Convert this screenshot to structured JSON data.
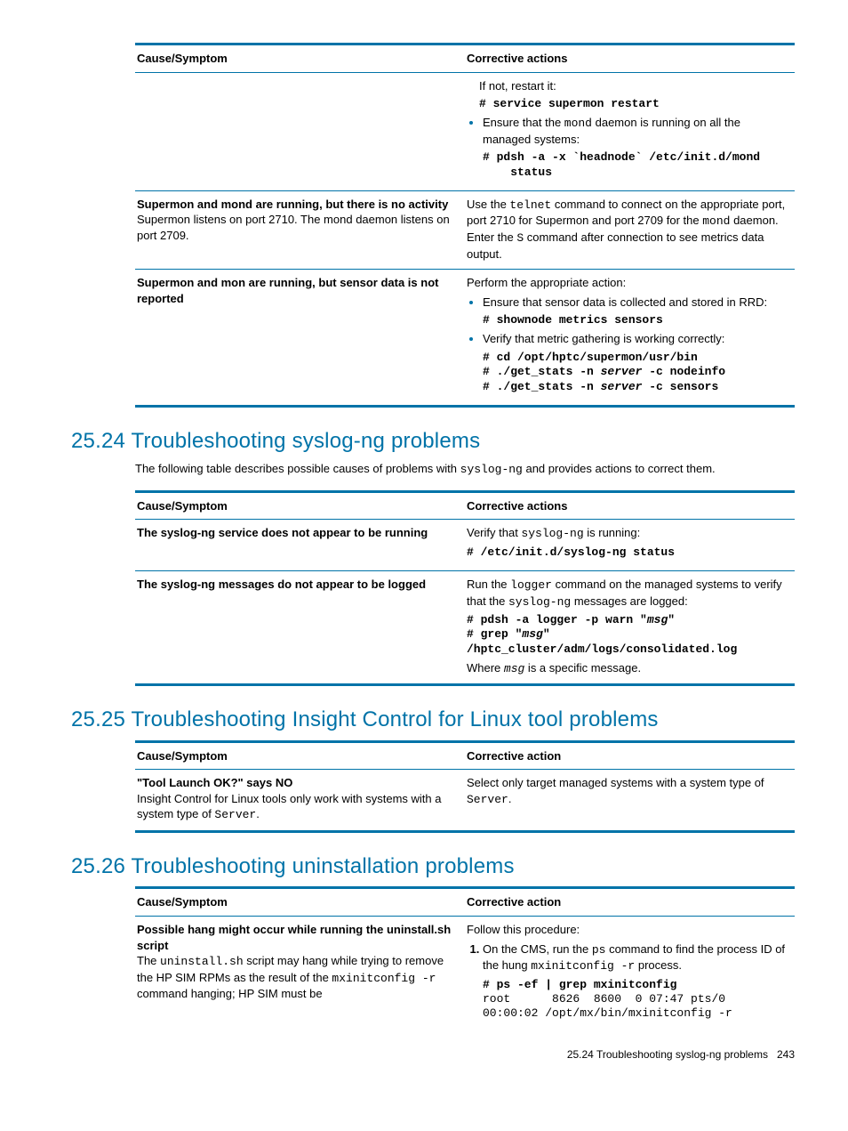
{
  "table1": {
    "headers": {
      "cause": "Cause/Symptom",
      "action": "Corrective actions"
    },
    "rows": [
      {
        "cause_bold": "",
        "cause_text": "",
        "action_intro": "If not, restart it:",
        "action_cmd1": "# service supermon restart",
        "action_bullet1_a": "Ensure that the ",
        "action_bullet1_mono": "mond",
        "action_bullet1_b": " daemon is running on all the managed systems:",
        "action_cmd2": "# pdsh -a -x `headnode` /etc/init.d/mond\n    status"
      },
      {
        "cause_bold": "Supermon and mond are running, but there is no activity",
        "cause_text_a": "Supermon listens on port 2710. The mond daemon listens on port 2709.",
        "action_a": "Use the ",
        "action_mono1": "telnet",
        "action_b": " command to connect on the appropriate port, port 2710 for Supermon and port 2709 for the ",
        "action_mono2": "mond",
        "action_c": " daemon. Enter the ",
        "action_mono3": "S",
        "action_d": " command after connection to see metrics data output."
      },
      {
        "cause_bold": "Supermon and mon are running, but sensor data is not reported",
        "action_intro": "Perform the appropriate action:",
        "bullet1": "Ensure that sensor data is collected and stored in RRD:",
        "cmd1": "# shownode metrics sensors",
        "bullet2": "Verify that metric gathering is working correctly:",
        "cmd2_l1": "# cd /opt/hptc/supermon/usr/bin",
        "cmd2_l2a": "# ./get_stats -n ",
        "cmd2_l2b": "server",
        "cmd2_l2c": " -c nodeinfo",
        "cmd2_l3a": "# ./get_stats -n ",
        "cmd2_l3b": "server",
        "cmd2_l3c": " -c sensors"
      }
    ]
  },
  "section24": {
    "heading": "25.24 Troubleshooting syslog-ng problems",
    "intro_a": "The following table describes possible causes of problems with ",
    "intro_mono": "syslog-ng",
    "intro_b": " and provides actions to correct them."
  },
  "table2": {
    "headers": {
      "cause": "Cause/Symptom",
      "action": "Corrective actions"
    },
    "rows": [
      {
        "cause_bold": "The syslog-ng service does not appear to be running",
        "action_a": "Verify that ",
        "action_mono": "syslog-ng",
        "action_b": " is running:",
        "cmd": "# /etc/init.d/syslog-ng status"
      },
      {
        "cause_bold": "The syslog-ng messages do not appear to be logged",
        "action_a": "Run the ",
        "action_mono1": "logger",
        "action_b": " command on the managed systems to verify that the ",
        "action_mono2": "syslog-ng",
        "action_c": " messages are logged:",
        "cmd_l1a": "# pdsh -a logger -p warn \"",
        "cmd_l1b": "msg",
        "cmd_l1c": "\"",
        "cmd_l2a": "# grep \"",
        "cmd_l2b": "msg",
        "cmd_l2c": "\"",
        "cmd_l3": "/hptc_cluster/adm/logs/consolidated.log",
        "tail_a": "Where ",
        "tail_mono": "msg",
        "tail_b": " is a specific message."
      }
    ]
  },
  "section25": {
    "heading": "25.25 Troubleshooting Insight Control for Linux tool problems"
  },
  "table3": {
    "headers": {
      "cause": "Cause/Symptom",
      "action": "Corrective action"
    },
    "row": {
      "cause_bold": "\"Tool Launch OK?\" says NO",
      "cause_text_a": "Insight Control for Linux tools only work with systems with a system type of ",
      "cause_text_mono": "Server",
      "cause_text_b": ".",
      "action_a": "Select only target managed systems with a system type of ",
      "action_mono": "Server",
      "action_b": "."
    }
  },
  "section26": {
    "heading": "25.26 Troubleshooting uninstallation problems"
  },
  "table4": {
    "headers": {
      "cause": "Cause/Symptom",
      "action": "Corrective action"
    },
    "row": {
      "cause_bold": "Possible hang might occur while running the uninstall.sh script",
      "cause_text_a": "The ",
      "cause_text_mono1": "uninstall.sh",
      "cause_text_b": " script may hang while trying to remove the HP SIM RPMs as the result of the ",
      "cause_text_mono2": "mxinitconfig -r",
      "cause_text_c": " command hanging; HP SIM must be",
      "action_intro": "Follow this procedure:",
      "step1_a": "On the CMS, run the ",
      "step1_mono1": "ps",
      "step1_b": " command to find the process ID of the hung ",
      "step1_mono2": "mxinitconfig -r",
      "step1_c": " process.",
      "cmd_l1": "# ps -ef | grep mxinitconfig",
      "cmd_l2": "root      8626  8600  0 07:47 pts/0",
      "cmd_l3": "00:00:02 /opt/mx/bin/mxinitconfig -r"
    }
  },
  "footer": {
    "text": "25.24 Troubleshooting syslog-ng problems",
    "page": "243"
  }
}
